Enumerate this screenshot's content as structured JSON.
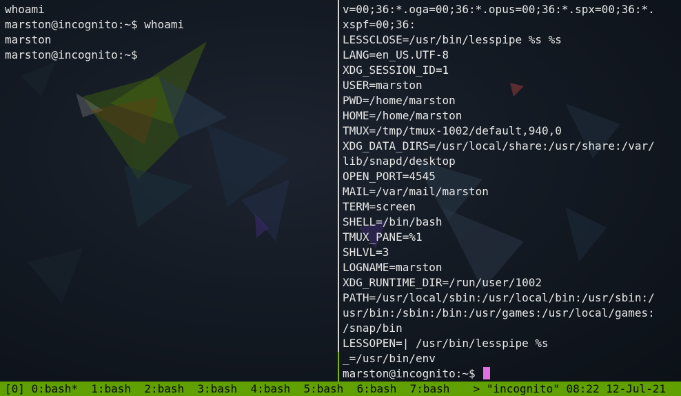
{
  "left_pane": {
    "lines": [
      "whoami",
      "marston@incognito:~$ whoami",
      "marston",
      "marston@incognito:~$"
    ]
  },
  "right_pane": {
    "lines": [
      "v=00;36:*.oga=00;36:*.opus=00;36:*.spx=00;36:*.",
      "xspf=00;36:",
      "LESSCLOSE=/usr/bin/lesspipe %s %s",
      "LANG=en_US.UTF-8",
      "XDG_SESSION_ID=1",
      "USER=marston",
      "PWD=/home/marston",
      "HOME=/home/marston",
      "TMUX=/tmp/tmux-1002/default,940,0",
      "XDG_DATA_DIRS=/usr/local/share:/usr/share:/var/",
      "lib/snapd/desktop",
      "OPEN_PORT=4545",
      "MAIL=/var/mail/marston",
      "TERM=screen",
      "SHELL=/bin/bash",
      "TMUX_PANE=%1",
      "SHLVL=3",
      "LOGNAME=marston",
      "XDG_RUNTIME_DIR=/run/user/1002",
      "PATH=/usr/local/sbin:/usr/local/bin:/usr/sbin:/",
      "usr/bin:/sbin:/bin:/usr/games:/usr/local/games:",
      "/snap/bin",
      "LESSOPEN=| /usr/bin/lesspipe %s",
      "_=/usr/bin/env"
    ],
    "prompt": "marston@incognito:~$ "
  },
  "status_bar": {
    "session": "[0]",
    "windows": [
      "0:bash*",
      "1:bash",
      "2:bash",
      "3:bash",
      "4:bash",
      "5:bash",
      "6:bash",
      "7:bash"
    ],
    "host": "> \"incognito\"",
    "time": "08:22",
    "date": "12-Jul-21"
  },
  "colors": {
    "status_bar_bg": "#60a000",
    "active_border": "#7fb800",
    "inactive_border": "#d8d8d8",
    "cursor": "#e070e0",
    "text": "#e6e6e6"
  }
}
